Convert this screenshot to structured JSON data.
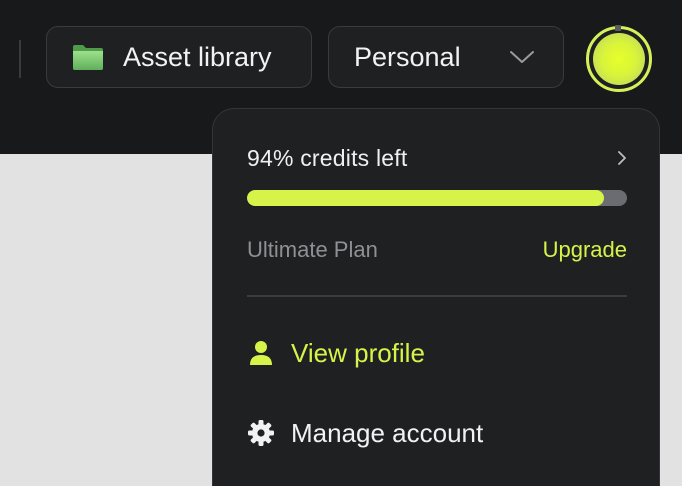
{
  "header": {
    "asset_library_label": "Asset library",
    "workspace_selected": "Personal"
  },
  "account_menu": {
    "credits_label": "94% credits left",
    "credits_fraction": 0.94,
    "plan_name": "Ultimate Plan",
    "upgrade_label": "Upgrade",
    "items": [
      {
        "label": "View profile",
        "icon": "person-icon"
      },
      {
        "label": "Manage account",
        "icon": "gear-icon"
      }
    ]
  },
  "colors": {
    "accent": "#d7f34a",
    "background": "#18191b",
    "menu_background": "#1f2022",
    "progress_track": "#6b6c72",
    "muted_text": "#8f9095"
  }
}
